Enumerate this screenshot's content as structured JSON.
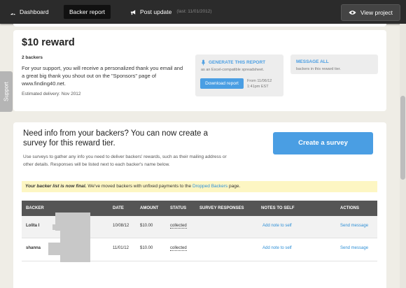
{
  "topbar": {
    "dashboard": "Dashboard",
    "backer_report": "Backer report",
    "post_update": "Post update",
    "post_update_sub": "(last: 11/01/2012)",
    "view_project": "View project"
  },
  "support_tab": "Support",
  "reward": {
    "title": "$10 reward",
    "backers_count": "2 backers",
    "description": "For your support, you will receive a personalized thank you email and a great big thank you shout out on the \"Sponsors\" page of www.finding40.net.",
    "estimated_delivery": "Estimated delivery: Nov 2012",
    "generate_title": "GENERATE THIS REPORT",
    "generate_sub": "as an Excel-compatible spreadsheet.",
    "download_button": "Download report",
    "download_from_line1": "From 11/06/12",
    "download_from_line2": "1:41pm EST",
    "message_title": "MESSAGE ALL",
    "message_sub": "backers in this reward tier."
  },
  "survey": {
    "heading": "Need info from your backers? You can now create a survey for this reward tier.",
    "body": "Use surveys to gather any info you need to deliver backers' rewards, such as their mailing address or other details. Responses will be listed next to each backer's name below.",
    "button": "Create a survey"
  },
  "notice": {
    "bold": "Your backer list is now final.",
    "text1": " We've moved backers with unfixed payments to the ",
    "link": "Dropped Backers",
    "text2": " page."
  },
  "table": {
    "headers": [
      "BACKER",
      "DATE",
      "AMOUNT",
      "STATUS",
      "SURVEY RESPONSES",
      "NOTES TO SELF",
      "ACTIONS"
    ],
    "rows": [
      {
        "backer": "Lolita I",
        "date": "10/08/12",
        "amount": "$10.00",
        "status": "collected",
        "notes": "Add note to self",
        "action": "Send message"
      },
      {
        "backer": "shanna",
        "date": "11/01/12",
        "amount": "$10.00",
        "status": "collected",
        "notes": "Add note to self",
        "action": "Send message"
      }
    ]
  },
  "colors": {
    "topbar": "#2b2b2b",
    "accent_blue": "#4a9ee3",
    "link_blue": "#2e8fd6",
    "notice_bg": "#fdf6c3",
    "table_header": "#555555"
  }
}
